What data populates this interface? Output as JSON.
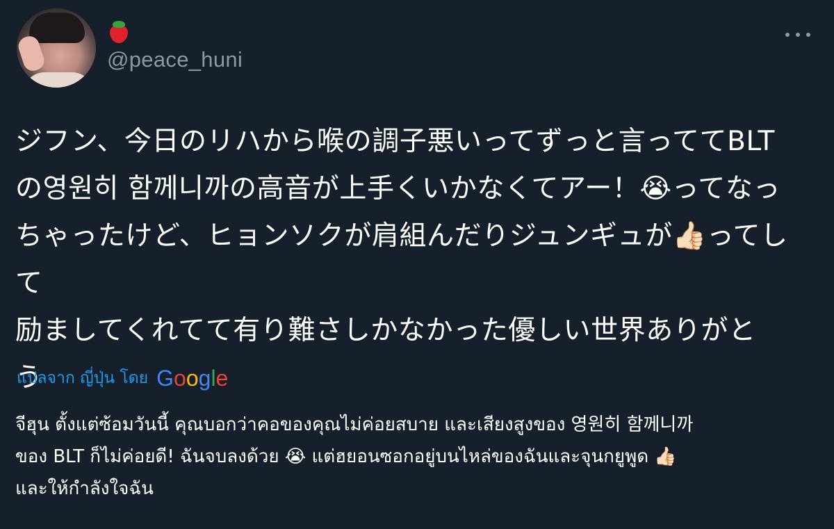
{
  "tweet": {
    "author": {
      "display_name": "🍓",
      "username": "@peace_huni"
    },
    "more_icon": "more-dots-icon",
    "text_lines": [
      "ジフン、今日のリハから喉の調子悪いってずっと言っててBLT",
      "の영원히 함께니까の高音が上手くいかなくてアー！😭ってなっ",
      "ちゃったけど、ヒョンソクが肩組んだりジュンギュが👍🏻ってして",
      "励ましてくれてて有り難さしかなかった優しい世界ありがと",
      "う"
    ],
    "translate": {
      "label": "แปลจาก ญี่ปุ่น โดย",
      "provider": "Google"
    },
    "translated_lines": [
      "จีฮุน ตั้งแต่ซ้อมวันนี้ คุณบอกว่าคอของคุณไม่ค่อยสบาย และเสียงสูงของ 영원히 함께니까",
      "ของ BLT ก็ไม่ค่อยดี! ฉันจบลงด้วย 😭 แต่ฮยอนซอกอยู่บนไหล่ของฉันและจุนกยูพูด 👍🏻",
      "และให้กำลังใจฉัน"
    ]
  },
  "colors": {
    "background": "#15202b",
    "secondary_text": "#8b98a5",
    "link": "#1d9bf0"
  }
}
